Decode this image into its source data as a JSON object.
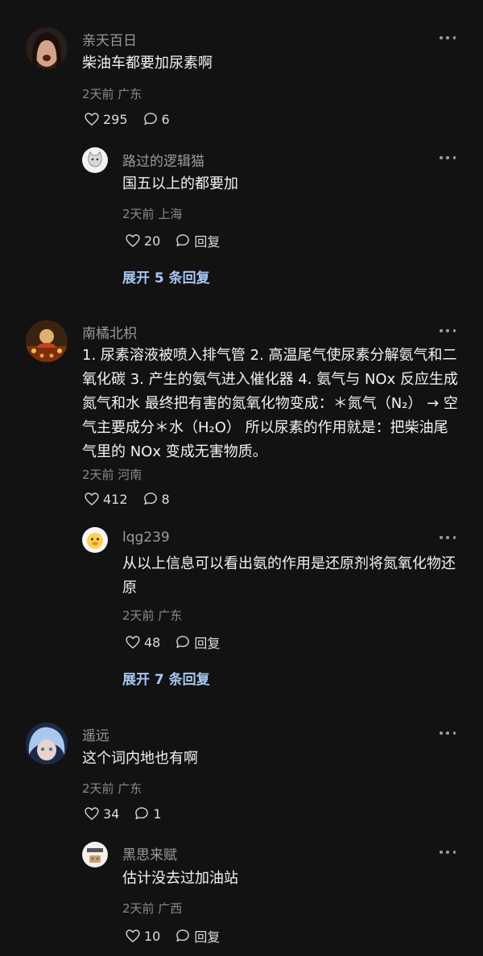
{
  "comments": [
    {
      "user": "亲天百日",
      "text": "柴油车都要加尿素啊",
      "meta": "2天前 广东",
      "likes": "295",
      "replies_count": "6",
      "reply": {
        "user": "路过的逻辑猫",
        "text": "国五以上的都要加",
        "meta": "2天前 上海",
        "likes": "20",
        "reply_label": "回复"
      },
      "expand_label": "展开 5 条回复"
    },
    {
      "user": "南橘北枳",
      "text": "1. 尿素溶液被喷入排气管 2. 高温尾气使尿素分解氨气和二氧化碳 3. 产生的氨气进入催化器 4. 氨气与 NOx 反应生成氮气和水 最终把有害的氮氧化物变成：＊氮气（N₂） → 空气主要成分＊水（H₂O） 所以尿素的作用就是：把柴油尾气里的 NOx 变成无害物质。",
      "meta": "2天前 河南",
      "likes": "412",
      "replies_count": "8",
      "reply": {
        "user": "lqg239",
        "text": "从以上信息可以看出氨的作用是还原剂将氮氧化物还原",
        "meta": "2天前 广东",
        "likes": "48",
        "reply_label": "回复"
      },
      "expand_label": "展开 7 条回复"
    },
    {
      "user": "遥远",
      "text": "这个词内地也有啊",
      "meta": "2天前 广东",
      "likes": "34",
      "replies_count": "1",
      "reply": {
        "user": "黑思来赋",
        "text": "估计没去过加油站",
        "meta": "2天前 广西",
        "likes": "10",
        "reply_label": "回复"
      }
    }
  ],
  "icons": {
    "like": "heart-outline-icon",
    "comment": "speech-bubble-icon",
    "more": "more-dots-icon"
  },
  "colors": {
    "background": "#121212",
    "primary_text": "#f2f2f2",
    "secondary_text": "#9b9b9b",
    "link": "#a6c8f2"
  }
}
